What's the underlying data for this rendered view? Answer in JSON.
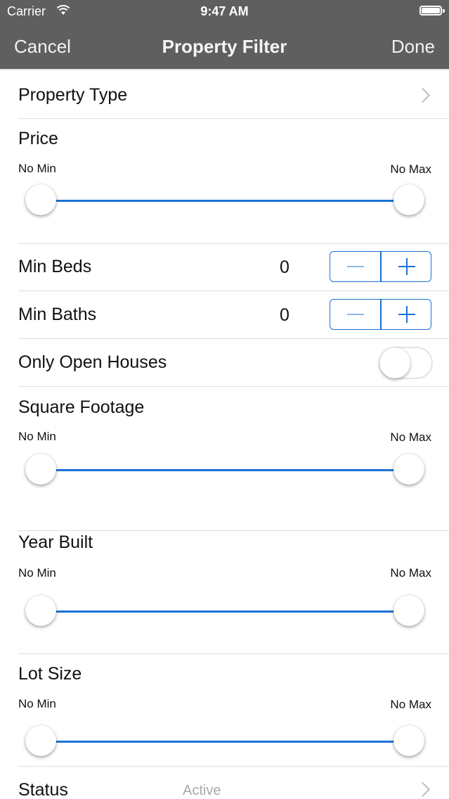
{
  "status_bar": {
    "carrier": "Carrier",
    "time": "9:47 AM",
    "wifi_icon": "wifi-icon",
    "battery_icon": "battery-icon"
  },
  "nav": {
    "left": "Cancel",
    "title": "Property Filter",
    "right": "Done"
  },
  "property_type": {
    "label": "Property Type",
    "icon": "chevron-right-icon"
  },
  "price": {
    "label": "Price",
    "min_label": "No Min",
    "max_label": "No Max"
  },
  "min_beds": {
    "label": "Min Beds",
    "value": "0"
  },
  "min_baths": {
    "label": "Min Baths",
    "value": "0"
  },
  "open_houses": {
    "label": "Only Open Houses",
    "on": false
  },
  "square_footage": {
    "label": "Square Footage",
    "min_label": "No Min",
    "max_label": "No Max"
  },
  "year_built": {
    "label": "Year Built",
    "min_label": "No Min",
    "max_label": "No Max"
  },
  "lot_size": {
    "label": "Lot Size",
    "min_label": "No Min",
    "max_label": "No Max"
  },
  "status": {
    "label": "Status",
    "value": "Active",
    "icon": "chevron-right-icon"
  },
  "colors": {
    "nav_bar": "#5f5f5f",
    "accent": "#1a72d6",
    "separator": "#dedede"
  }
}
